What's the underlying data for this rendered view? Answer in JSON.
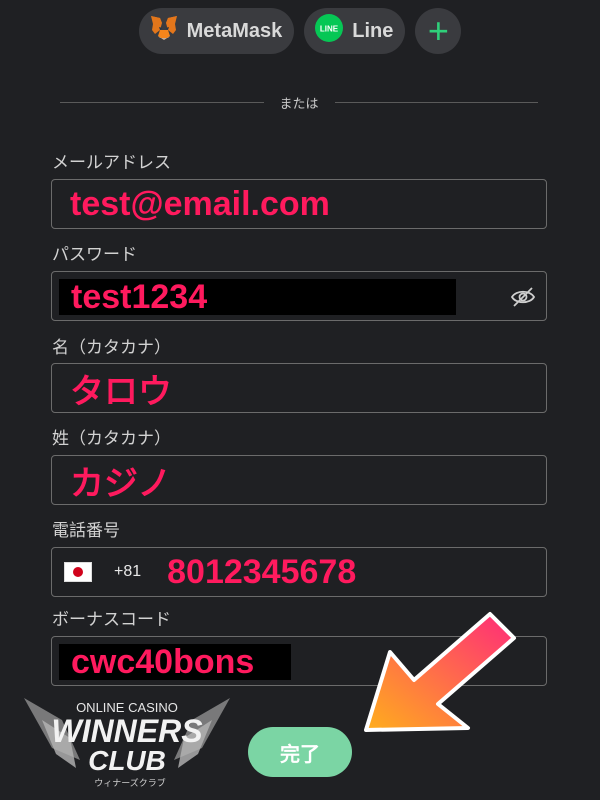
{
  "social": {
    "metamask_label": "MetaMask",
    "line_label": "Line",
    "line_icon_text": "LINE",
    "add_label": "+"
  },
  "divider_text": "または",
  "form": {
    "email": {
      "label": "メールアドレス",
      "value": "test@email.com"
    },
    "password": {
      "label": "パスワード",
      "value": "test1234"
    },
    "first_name": {
      "label": "名（カタカナ）",
      "value": "タロウ"
    },
    "last_name": {
      "label": "姓（カタカナ）",
      "value": "カジノ"
    },
    "phone": {
      "label": "電話番号",
      "country_code": "+81",
      "value": "8012345678"
    },
    "bonus": {
      "label": "ボーナスコード",
      "value": "cwc40bons"
    }
  },
  "submit_label": "完了",
  "logo": {
    "line1": "ONLINE CASINO",
    "line2": "WINNERS",
    "line3": "CLUB",
    "line4": "ウィナーズクラブ"
  },
  "colors": {
    "background": "#1f2023",
    "accent_green": "#2fd07a",
    "highlight_pink": "#ff1a5e",
    "submit_green": "#7bd5a4",
    "arrow_orange": "#ff8a1c",
    "arrow_pink": "#ff2a7a"
  },
  "icons": [
    "metamask-icon",
    "line-icon",
    "plus-icon",
    "eye-slash-icon",
    "japan-flag-icon",
    "arrow-icon"
  ]
}
